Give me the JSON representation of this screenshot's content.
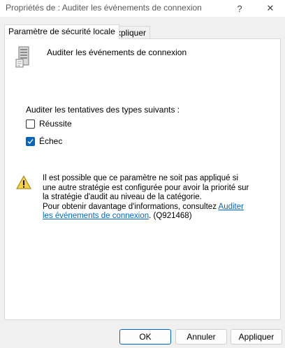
{
  "window": {
    "title": "Propriétés de : Auditer les événements de connexion",
    "help_glyph": "?",
    "close_glyph": "✕"
  },
  "tabs": [
    {
      "label": "Paramètre de sécurité locale",
      "active": true
    },
    {
      "label": "Expliquer",
      "active": false
    }
  ],
  "policy": {
    "icon": "server-icon",
    "name": "Auditer les événements de connexion"
  },
  "audit": {
    "group_label": "Auditer les tentatives des types suivants :",
    "options": [
      {
        "label": "Réussite",
        "checked": false
      },
      {
        "label": "Échec",
        "checked": true
      }
    ]
  },
  "warning": {
    "icon": "warning-icon",
    "text_line1": "Il est possible que ce paramètre ne soit pas appliqué si une autre stratégie est configurée pour avoir la priorité sur la stratégie d'audit au niveau de la catégorie.",
    "text_line2_prefix": "Pour obtenir davantage d'informations, consultez ",
    "link_text": "Auditer les événements de connexion",
    "suffix": ". (Q921468)"
  },
  "buttons": {
    "ok": "OK",
    "cancel": "Annuler",
    "apply": "Appliquer"
  },
  "colors": {
    "accent": "#0067c0",
    "link": "#0066cc",
    "warning_yellow": "#f5d142"
  }
}
